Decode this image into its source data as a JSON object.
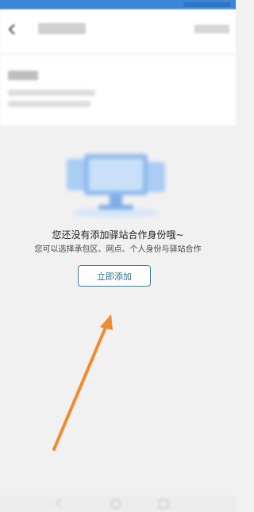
{
  "empty_state": {
    "title": "您还没有添加驿站合作身份哦~",
    "subtitle": "您可以选择承包区、网点、个人身份与驿站合作",
    "add_button_label": "立即添加"
  },
  "icons": {
    "back": "back-arrow-icon",
    "illustration": "computer-empty-illustration",
    "annotation": "orange-arrow-annotation",
    "nav_back": "nav-back-icon",
    "nav_home": "nav-home-icon",
    "nav_recent": "nav-recent-icon"
  },
  "colors": {
    "status_bar": "#3a86d8",
    "button_border": "#3c7f99",
    "annotation_arrow": "#f28a2e",
    "illustration": "#8fb9ec"
  }
}
